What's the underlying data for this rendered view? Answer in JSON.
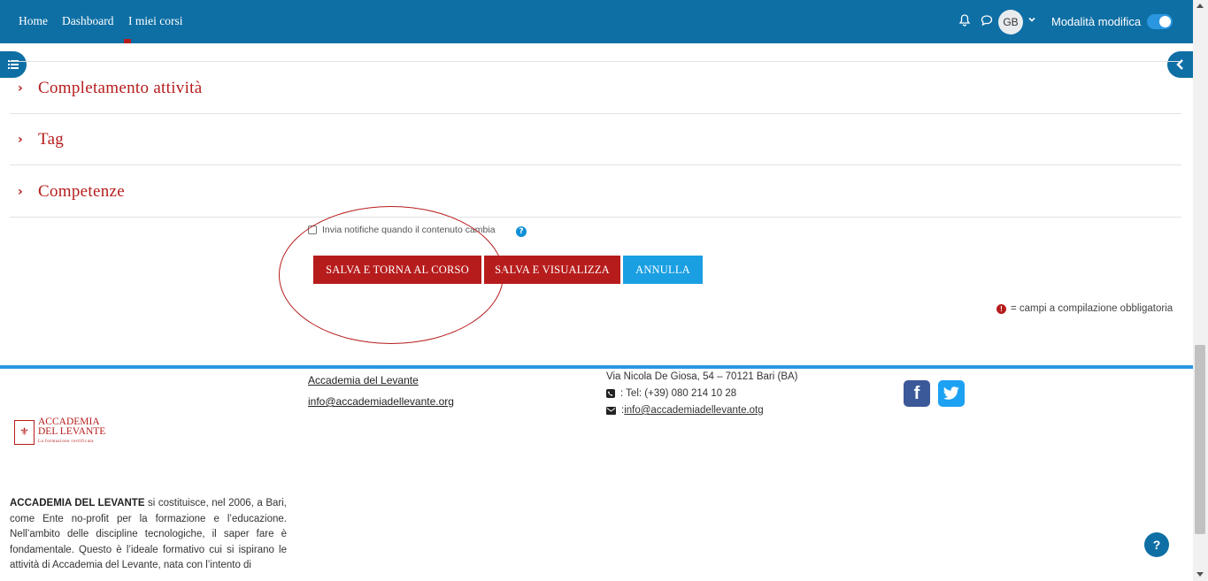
{
  "nav": {
    "home": "Home",
    "dashboard": "Dashboard",
    "my_courses": "I miei corsi",
    "avatar_initials": "GB",
    "edit_mode_label": "Modalità modifica",
    "edit_mode_on": true,
    "icons": [
      "bell-icon",
      "chat-icon",
      "chevron-down-icon"
    ]
  },
  "sections": [
    {
      "label": "Completamento attività"
    },
    {
      "label": "Tag"
    },
    {
      "label": "Competenze"
    }
  ],
  "notify": {
    "label": "Invia notifiche quando il contenuto cambia",
    "checked": false
  },
  "buttons": {
    "save_return": "SALVA E TORNA AL CORSO",
    "save_display": "SALVA E VISUALIZZA",
    "cancel": "ANNULLA"
  },
  "required_note": "= campi a compilazione obbligatoria",
  "footer": {
    "logo_line1": "ACCADEMIA",
    "logo_line2": "DEL LEVANTE",
    "logo_tagline": "La formazione certificata",
    "org_link": "Accademia del Levante",
    "email_link": "info@accademiadellevante.org",
    "address": "Via Nicola De Giosa, 54 – 70121 Bari (BA)",
    "phone": ": Tel: (+39) 080 214 10 28",
    "email_prefix": ": ",
    "email2": "info@accademiadellevante.otg",
    "about_bold": "ACCADEMIA DEL LEVANTE",
    "about_text": " si costituisce, nel 2006, a Bari, come Ente no-profit per la formazione e l’educazione. Nell’ambito delle discipline tecnologiche, il saper fare è fondamentale. Questo è l’ideale formativo cui si ispirano le attività di Accademia del Levante, nata con l’intento di"
  },
  "colors": {
    "navbar": "#0e6fa5",
    "accent_red": "#b71c1c",
    "accent_blue": "#1a9fe3"
  }
}
